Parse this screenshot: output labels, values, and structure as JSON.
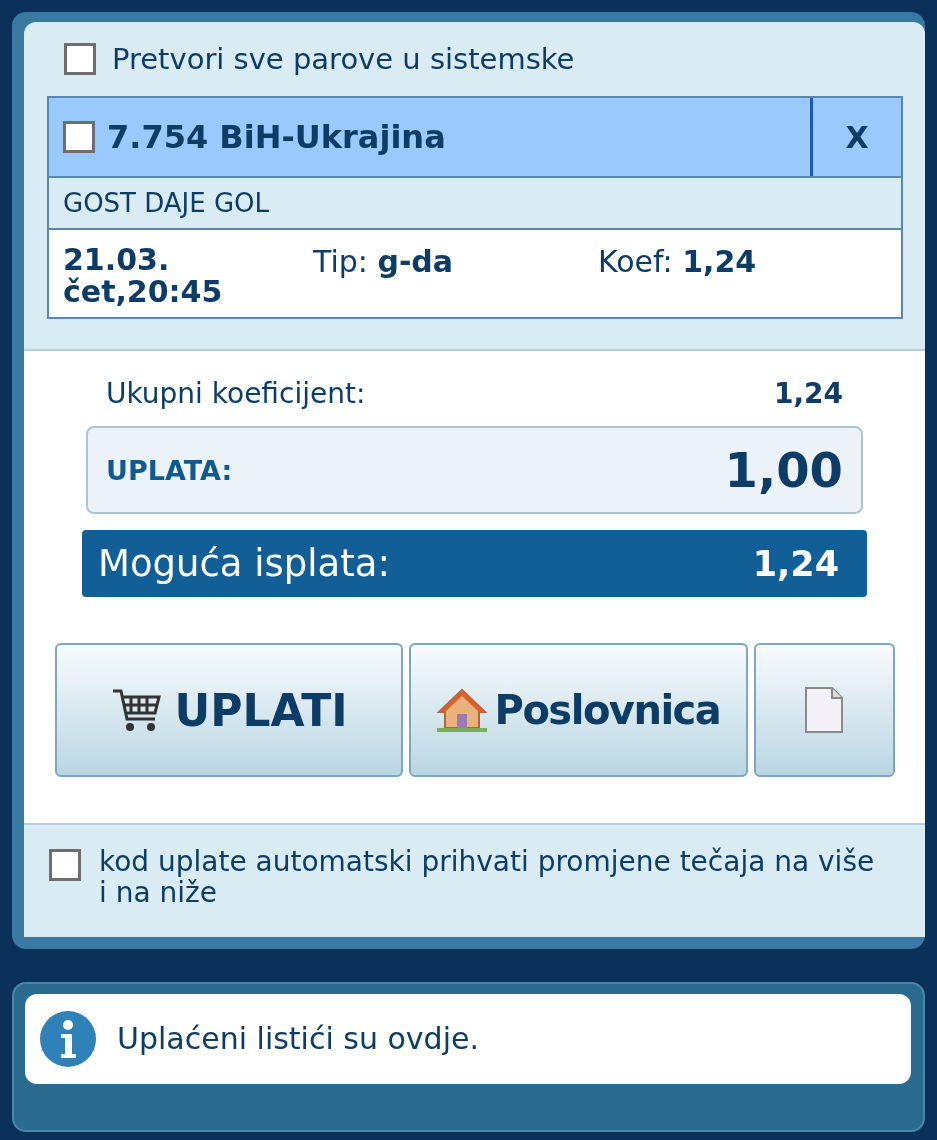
{
  "system_checkbox": {
    "label": "Pretvori sve parove u sistemske",
    "checked": false
  },
  "pairs": [
    {
      "checked": false,
      "title": "7.754 BiH-Ukrajina",
      "remove": "X",
      "market": "GOST DAJE GOL",
      "date": "21.03. čet,20:45",
      "tip": "Tip: **g-da**",
      "odds": "Koef: **1,24**"
    }
  ],
  "total": {
    "label": "Ukupni koeficijent:",
    "value": "1,24"
  },
  "stake": {
    "label": "UPLATA:",
    "value": "1,00"
  },
  "payout": {
    "label": "Moguća isplata:",
    "value": "1,24"
  },
  "buttons": [
    {
      "kind": "cart",
      "label": "UPLATI"
    },
    {
      "kind": "house",
      "label": "Poslovnica"
    },
    {
      "kind": "document"
    }
  ],
  "auto_accept": {
    "label": "kod uplate automatski prihvati promjene tečaja na više i na niže",
    "checked": false
  },
  "info": {
    "text": "Uplaćeni listići su ovdje."
  }
}
